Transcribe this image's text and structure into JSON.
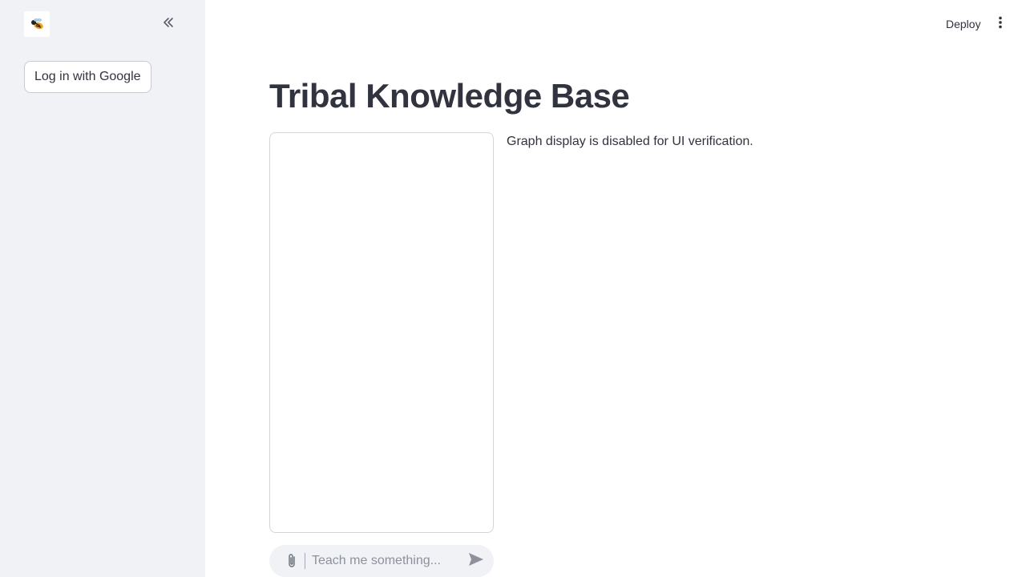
{
  "sidebar": {
    "logo_icon": "wasp-logo-icon",
    "collapse_icon": "double-chevron-left-icon",
    "login_label": "Log in with Google"
  },
  "header": {
    "deploy_label": "Deploy",
    "menu_icon": "vertical-dots-icon"
  },
  "main": {
    "title": "Tribal Knowledge Base",
    "graph_note": "Graph display is disabled for UI verification.",
    "chat": {
      "placeholder": "Teach me something...",
      "attach_icon": "paperclip-icon",
      "send_icon": "send-icon"
    }
  },
  "colors": {
    "sidebar_bg": "#f0f2f6",
    "text": "#31333f",
    "border": "#d3d5db"
  }
}
